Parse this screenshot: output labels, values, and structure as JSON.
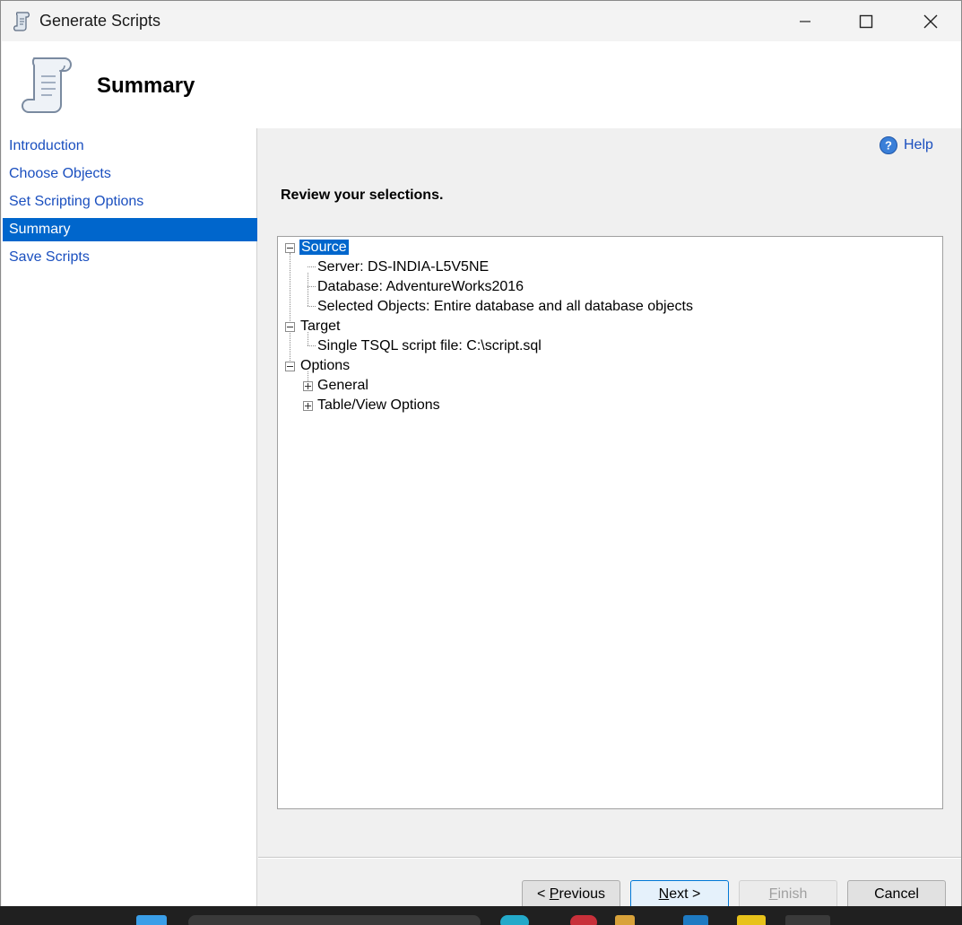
{
  "window": {
    "title": "Generate Scripts",
    "icons": {
      "app": "scroll-icon",
      "minimize": "minimize-icon",
      "maximize": "maximize-icon",
      "close": "close-icon"
    }
  },
  "header": {
    "title": "Summary",
    "icon": "scroll-icon"
  },
  "nav": {
    "items": [
      {
        "label": "Introduction"
      },
      {
        "label": "Choose Objects"
      },
      {
        "label": "Set Scripting Options"
      },
      {
        "label": "Summary",
        "active": true
      },
      {
        "label": "Save Scripts"
      }
    ]
  },
  "main": {
    "help_label": "Help",
    "review_heading": "Review your selections.",
    "tree": {
      "source": {
        "label": "Source",
        "server": "Server: DS-INDIA-L5V5NE",
        "database": "Database: AdventureWorks2016",
        "selected_objects": "Selected Objects: Entire database and all database objects"
      },
      "target": {
        "label": "Target",
        "file": "Single TSQL script file: C:\\script.sql"
      },
      "options": {
        "label": "Options",
        "general": "General",
        "table_view": "Table/View Options"
      }
    }
  },
  "buttons": {
    "previous_prefix": "< ",
    "previous_key": "P",
    "previous_rest": "revious",
    "next_key": "N",
    "next_rest": "ext >",
    "finish_key": "F",
    "finish_rest": "inish",
    "cancel": "Cancel"
  },
  "colors": {
    "accent": "#0066cc",
    "link": "#1a4fbf"
  }
}
